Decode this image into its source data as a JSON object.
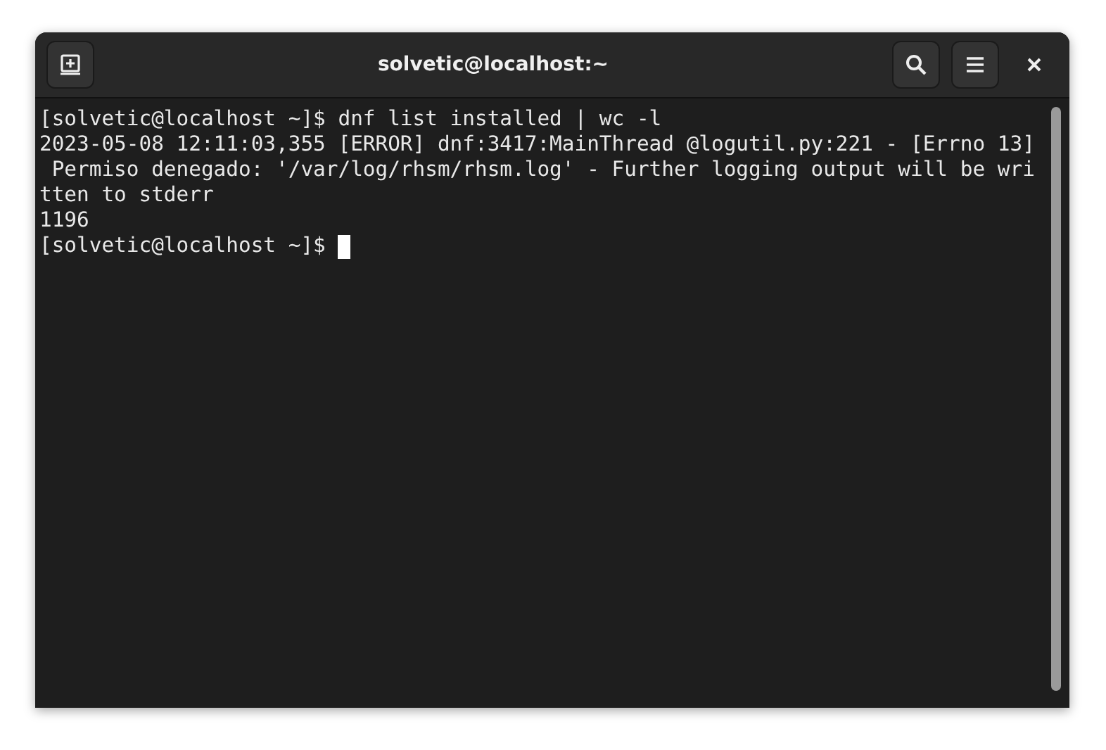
{
  "window": {
    "title": "solvetic@localhost:~"
  },
  "terminal": {
    "lines": [
      "[solvetic@localhost ~]$ dnf list installed | wc -l",
      "2023-05-08 12:11:03,355 [ERROR] dnf:3417:MainThread @logutil.py:221 - [Errno 13]",
      " Permiso denegado: '/var/log/rhsm/rhsm.log' - Further logging output will be wri",
      "tten to stderr",
      "1196",
      "[solvetic@localhost ~]$ "
    ],
    "cursor": true
  }
}
